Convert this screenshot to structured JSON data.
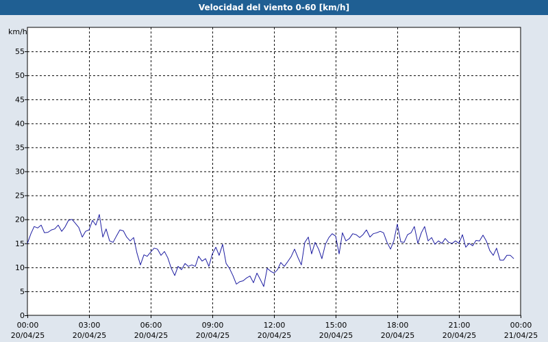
{
  "title": "Velocidad del viento 0-60 [km/h]",
  "colors": {
    "title_bar": "#1f5f93",
    "background": "#dfe6ee",
    "plot_background": "#ffffff",
    "line": "#1a1aa0",
    "grid": "#000000"
  },
  "chart_data": {
    "type": "line",
    "title": "Velocidad del viento 0-60 [km/h]",
    "ylabel": "km/h",
    "xlabel": "",
    "ylim": [
      0,
      60
    ],
    "yticks": [
      0,
      5,
      10,
      15,
      20,
      25,
      30,
      35,
      40,
      45,
      50,
      55
    ],
    "xlim_hours": [
      0,
      24
    ],
    "grid": true,
    "xticks": [
      {
        "time": "00:00",
        "date": "20/04/25"
      },
      {
        "time": "03:00",
        "date": "20/04/25"
      },
      {
        "time": "06:00",
        "date": "20/04/25"
      },
      {
        "time": "09:00",
        "date": "20/04/25"
      },
      {
        "time": "12:00",
        "date": "20/04/25"
      },
      {
        "time": "15:00",
        "date": "20/04/25"
      },
      {
        "time": "18:00",
        "date": "20/04/25"
      },
      {
        "time": "21:00",
        "date": "20/04/25"
      },
      {
        "time": "00:00",
        "date": "21/04/25"
      }
    ],
    "series": [
      {
        "x_hours": [
          0.0,
          0.17,
          0.33,
          0.5,
          0.67,
          0.83,
          1.0,
          1.17,
          1.33,
          1.5,
          1.67,
          1.83,
          2.0,
          2.17,
          2.33,
          2.5,
          2.67,
          2.83,
          3.0,
          3.17,
          3.33,
          3.5,
          3.67,
          3.83,
          4.0,
          4.17,
          4.33,
          4.5,
          4.67,
          4.83,
          5.0,
          5.17,
          5.33,
          5.5,
          5.67,
          5.83,
          6.0,
          6.17,
          6.33,
          6.5,
          6.67,
          6.83,
          7.0,
          7.17,
          7.33,
          7.5,
          7.67,
          7.83,
          8.0,
          8.17,
          8.33,
          8.5,
          8.67,
          8.83,
          9.0,
          9.17,
          9.33,
          9.5,
          9.67,
          9.83,
          10.0,
          10.17,
          10.33,
          10.5,
          10.67,
          10.83,
          11.0,
          11.17,
          11.33,
          11.5,
          11.67,
          11.83,
          12.0,
          12.17,
          12.33,
          12.5,
          12.67,
          12.83,
          13.0,
          13.17,
          13.33,
          13.5,
          13.67,
          13.83,
          14.0,
          14.17,
          14.33,
          14.5,
          14.67,
          14.83,
          15.0,
          15.17,
          15.33,
          15.5,
          15.67,
          15.83,
          16.0,
          16.17,
          16.33,
          16.5,
          16.67,
          16.83,
          17.0,
          17.17,
          17.33,
          17.5,
          17.67,
          17.83,
          18.0,
          18.17,
          18.33,
          18.5,
          18.67,
          18.83,
          19.0,
          19.17,
          19.33,
          19.5,
          19.67,
          19.83,
          20.0,
          20.17,
          20.33,
          20.5,
          20.67,
          20.83,
          21.0,
          21.17,
          21.33,
          21.5,
          21.67,
          21.83,
          22.0,
          22.17,
          22.33,
          22.5,
          22.67,
          22.83,
          23.0,
          23.17,
          23.33,
          23.5,
          23.67
        ],
        "values": [
          15.0,
          17.0,
          18.5,
          18.2,
          18.8,
          17.2,
          17.3,
          17.8,
          18.0,
          18.8,
          17.5,
          18.4,
          19.8,
          20.0,
          19.2,
          18.3,
          16.3,
          17.5,
          17.8,
          19.8,
          18.8,
          21.0,
          16.3,
          18.0,
          15.5,
          15.2,
          16.5,
          17.8,
          17.6,
          16.3,
          15.5,
          16.2,
          13.0,
          10.5,
          12.6,
          12.3,
          13.2,
          14.0,
          13.8,
          12.5,
          13.3,
          12.0,
          9.8,
          8.3,
          10.2,
          9.5,
          10.8,
          10.2,
          10.5,
          10.2,
          12.3,
          11.3,
          11.8,
          10.2,
          12.8,
          14.2,
          12.5,
          14.8,
          10.8,
          9.8,
          8.3,
          6.5,
          7.0,
          7.2,
          7.8,
          8.2,
          6.8,
          8.8,
          7.5,
          6.0,
          9.8,
          9.2,
          8.8,
          9.5,
          11.0,
          10.2,
          11.2,
          12.2,
          13.8,
          12.0,
          10.5,
          15.2,
          16.3,
          12.8,
          15.2,
          13.8,
          11.8,
          14.8,
          16.2,
          17.0,
          16.5,
          12.8,
          17.2,
          15.5,
          16.0,
          17.0,
          16.8,
          16.2,
          16.8,
          17.8,
          16.3,
          17.0,
          17.2,
          17.5,
          17.2,
          15.2,
          13.8,
          15.5,
          19.0,
          15.3,
          15.2,
          16.8,
          17.2,
          18.5,
          15.0,
          17.2,
          18.5,
          15.5,
          16.2,
          14.8,
          15.5,
          15.0,
          16.0,
          15.2,
          15.0,
          15.5,
          15.0,
          16.8,
          14.2,
          15.0,
          14.5,
          15.6,
          15.5,
          16.7,
          15.5,
          13.5,
          12.5,
          14.0,
          11.5,
          11.5,
          12.5,
          12.5,
          11.8,
          12.0
        ]
      }
    ]
  }
}
